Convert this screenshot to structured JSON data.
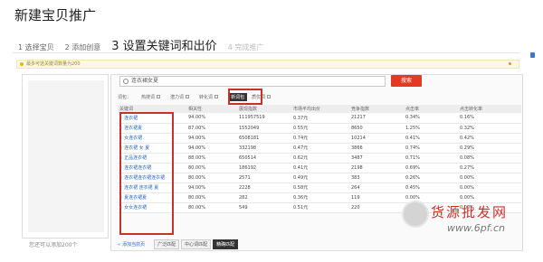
{
  "page": {
    "title": "新建宝贝推广"
  },
  "steps": [
    {
      "label": "1 选择宝贝",
      "state": "done"
    },
    {
      "label": "2 添加创意",
      "state": "done"
    },
    {
      "label": "3 设置关键词和出价",
      "state": "active"
    },
    {
      "label": "4 完成推广",
      "state": "todo"
    }
  ],
  "notice": {
    "text": "最多可选关键词数量为200"
  },
  "search": {
    "value": "连衣裙女夏",
    "button_label": "搜索"
  },
  "filters": [
    "词包：",
    "热搜词",
    "潜力词",
    "转化词",
    "新词包",
    "质优词"
  ],
  "table": {
    "columns": [
      "关键词",
      "相关性",
      "展现指数",
      "市场平均出价",
      "竞争指数",
      "点击率",
      "点击转化率"
    ],
    "rows": [
      [
        "连衣裙",
        "94.00%",
        "111957519",
        "0.37元",
        "21217",
        "0.34%",
        "0.16%"
      ],
      [
        "连衣裙夏",
        "87.00%",
        "1552049",
        "0.55元",
        "8650",
        "1.25%",
        "0.32%"
      ],
      [
        "女连衣裙",
        "94.00%",
        "6508181",
        "0.74元",
        "10214",
        "0.41%",
        "0.42%"
      ],
      [
        "连衣裙 女 夏",
        "94.00%",
        "332198",
        "0.47元",
        "3866",
        "0.74%",
        "0.29%"
      ],
      [
        "正品连衣裙",
        "88.00%",
        "650514",
        "0.62元",
        "3487",
        "0.71%",
        "0.08%"
      ],
      [
        "连衣裙连衣裙",
        "80.00%",
        "186192",
        "0.41元",
        "2198",
        "0.69%",
        "0.27%"
      ],
      [
        "连衣裙连衣裙连衣裙",
        "80.00%",
        "2571",
        "0.49元",
        "383",
        "0.26%",
        "0.00%"
      ],
      [
        "连衣裙 连衣裙 夏",
        "94.00%",
        "2228",
        "0.58元",
        "264",
        "0.45%",
        "0.00%"
      ],
      [
        "夏连衣裙夏",
        "80.00%",
        "282",
        "0.36元",
        "119",
        "0.00%",
        "0.00%"
      ],
      [
        "女女连衣裙",
        "80.00%",
        "549",
        "0.51元",
        "220",
        "0.00%",
        "0.00%"
      ]
    ]
  },
  "left_panel": {
    "count_label": "您还可以添加200个"
  },
  "bottom": {
    "add_all_label": "添加当前页",
    "match_labels": [
      "广泛匹配",
      "中心词匹配",
      "精确匹配"
    ]
  },
  "watermark": {
    "text": "货源批发网",
    "url": "www.6pf.cn"
  },
  "colors": {
    "accent": "#e23b21",
    "link": "#2a6ac8",
    "highlight_box": "#c7322c"
  }
}
